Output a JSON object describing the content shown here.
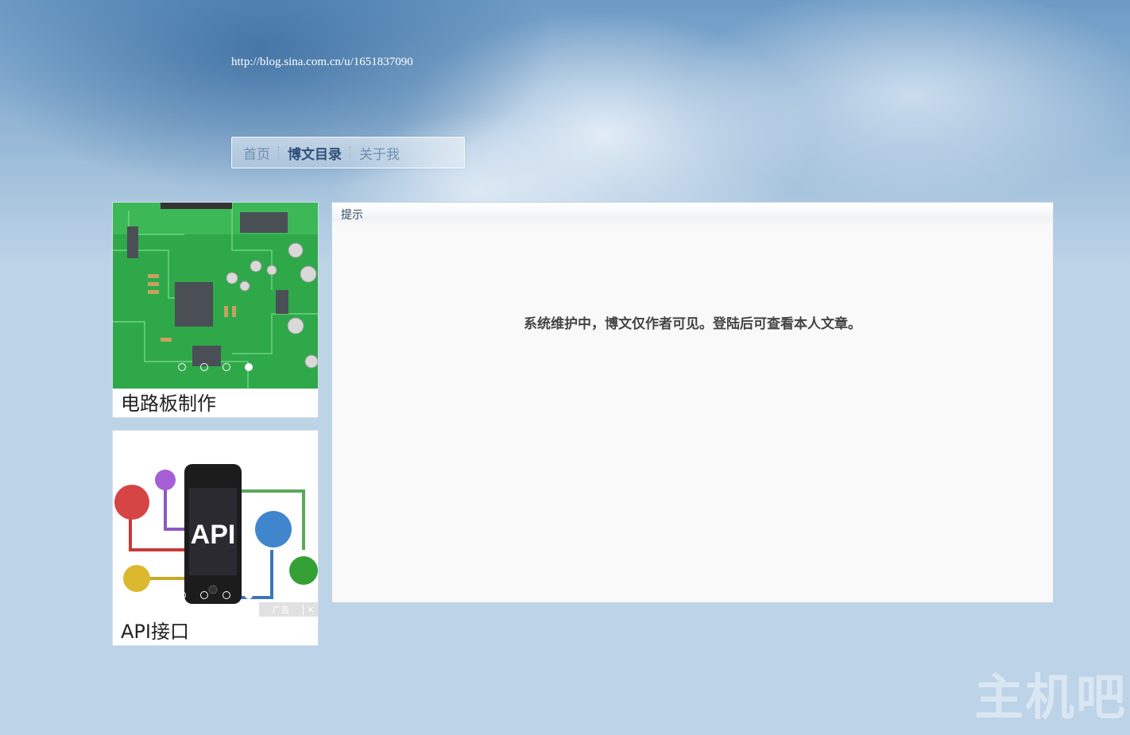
{
  "header": {
    "url": "http://blog.sina.com.cn/u/1651837090"
  },
  "nav": {
    "items": [
      {
        "label": "首页",
        "active": false
      },
      {
        "label": "博文目录",
        "active": true
      },
      {
        "label": "关于我",
        "active": false
      }
    ]
  },
  "ads": [
    {
      "caption": "电路板制作",
      "image": "circuit-board-image",
      "dots": 4,
      "active_dot": 4
    },
    {
      "caption": "API接口",
      "image": "api-phone-image",
      "dots": 4,
      "active_dot": 4,
      "ad_label": "广告",
      "close": "✕"
    }
  ],
  "panel": {
    "title": "提示",
    "message": "系统维护中，博文仅作者可见。登陆后可查看本人文章。"
  },
  "watermark": "主机吧",
  "colors": {
    "nav_active": "#2f4f78",
    "nav_inactive": "#6f90b0",
    "pcb_green": "#2fa84a",
    "background": "#bcd3e8"
  }
}
